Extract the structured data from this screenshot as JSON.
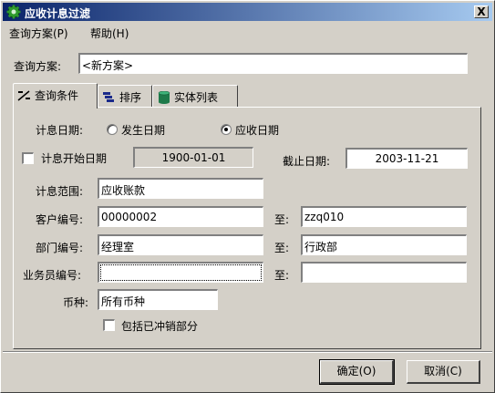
{
  "window": {
    "title": "应收计息过滤",
    "close_label": "X"
  },
  "menu": {
    "items": [
      "查询方案(P)",
      "帮助(H)"
    ]
  },
  "scheme": {
    "label": "查询方案:",
    "value": "<新方案>"
  },
  "tabs": [
    {
      "label": "查询条件",
      "icon": "filter-icon"
    },
    {
      "label": "排序",
      "icon": "sort-icon"
    },
    {
      "label": "实体列表",
      "icon": "database-icon"
    }
  ],
  "form": {
    "interest_date_label": "计息日期:",
    "radio_occur": "发生日期",
    "radio_receivable": "应收日期",
    "start_date_label": "计息开始日期",
    "start_date_value": "1900-01-01",
    "end_date_label": "截止日期:",
    "end_date_value": "2003-11-21",
    "range_label": "计息范围:",
    "range_value": "应收账款",
    "customer_label": "客户编号:",
    "customer_from": "00000002",
    "customer_to": "zzq010",
    "dept_label": "部门编号:",
    "dept_from": "经理室",
    "dept_to": "行政部",
    "salesman_label": "业务员编号:",
    "salesman_from": "",
    "salesman_to": "",
    "to_label": "至:",
    "currency_label": "币种:",
    "currency_value": "所有币种",
    "include_label": "包括已冲销部分"
  },
  "buttons": {
    "ok": "确定(O)",
    "cancel": "取消(C)"
  }
}
